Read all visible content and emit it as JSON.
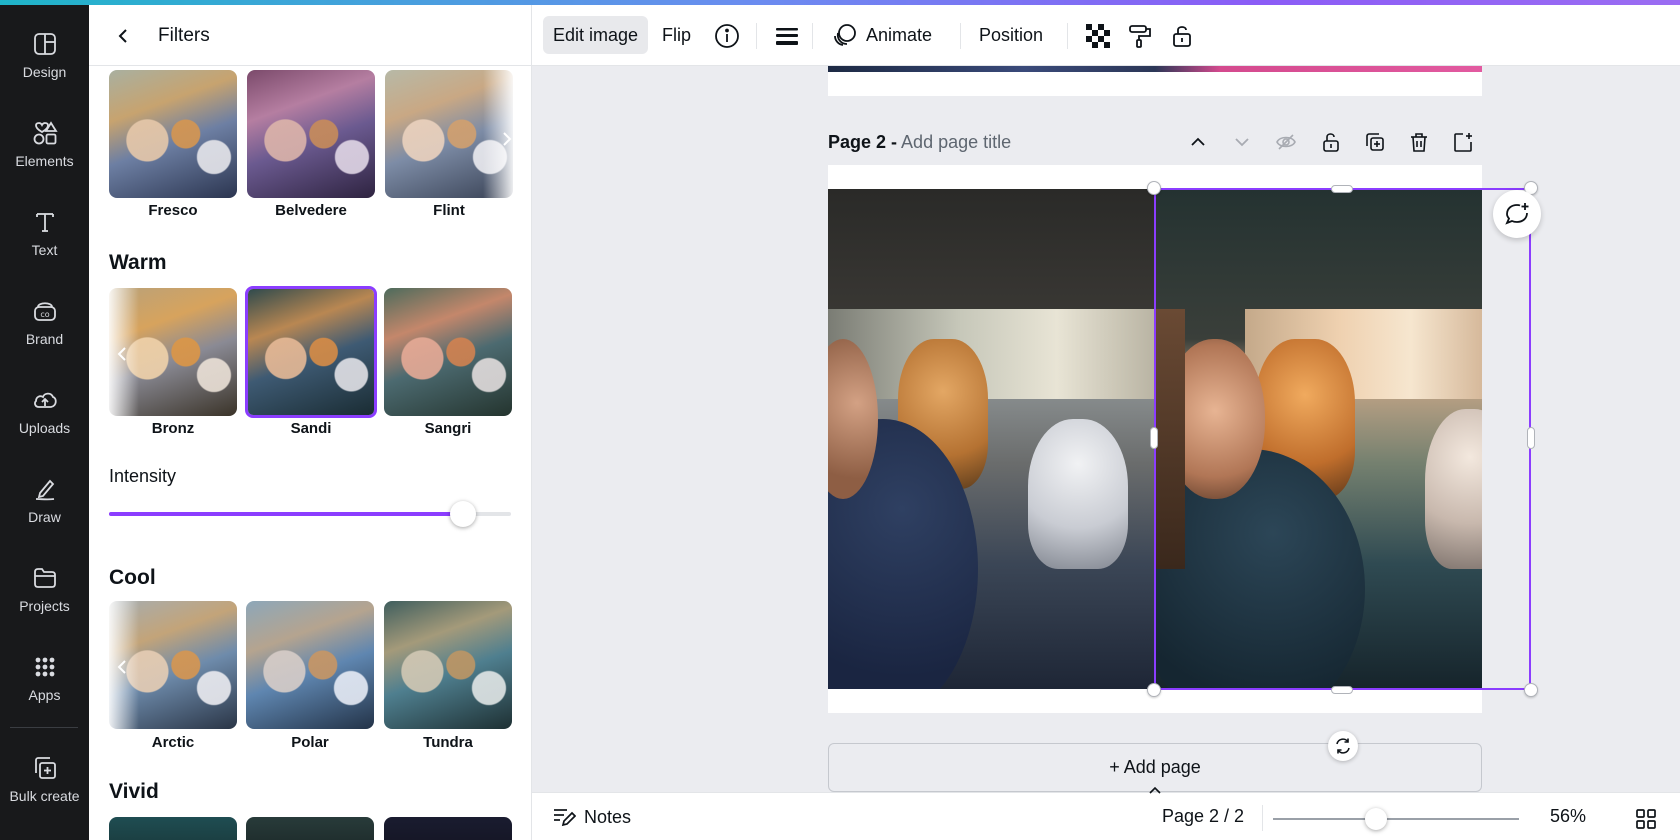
{
  "rail": {
    "items": [
      {
        "label": "Design",
        "icon": "design-icon"
      },
      {
        "label": "Elements",
        "icon": "elements-icon"
      },
      {
        "label": "Text",
        "icon": "text-icon"
      },
      {
        "label": "Brand",
        "icon": "brand-icon"
      },
      {
        "label": "Uploads",
        "icon": "uploads-icon"
      },
      {
        "label": "Draw",
        "icon": "draw-icon"
      },
      {
        "label": "Projects",
        "icon": "projects-icon"
      },
      {
        "label": "Apps",
        "icon": "apps-icon"
      },
      {
        "label": "Bulk create",
        "icon": "bulk-create-icon"
      }
    ]
  },
  "panel": {
    "title": "Filters",
    "sections": {
      "top": {
        "filters": [
          "Fresco",
          "Belvedere",
          "Flint"
        ]
      },
      "warm": {
        "title": "Warm",
        "filters": [
          "Bronz",
          "Sandi",
          "Sangri"
        ],
        "selected": "Sandi"
      },
      "cool": {
        "title": "Cool",
        "filters": [
          "Arctic",
          "Polar",
          "Tundra"
        ]
      },
      "vivid": {
        "title": "Vivid"
      }
    },
    "intensity": {
      "label": "Intensity",
      "value": 0.88
    }
  },
  "toolbar": {
    "edit_image": "Edit image",
    "flip": "Flip",
    "animate": "Animate",
    "position": "Position"
  },
  "canvas": {
    "page_label": "Page 2 -",
    "page_title_placeholder": "Add page title",
    "add_page": "+ Add page"
  },
  "footer": {
    "notes": "Notes",
    "pager": "Page 2 / 2",
    "zoom": "56%",
    "zoom_level": 0.42
  },
  "colors": {
    "accent": "#8b3dff",
    "rail_bg": "#18191b",
    "canvas_bg": "#ebecf0"
  }
}
